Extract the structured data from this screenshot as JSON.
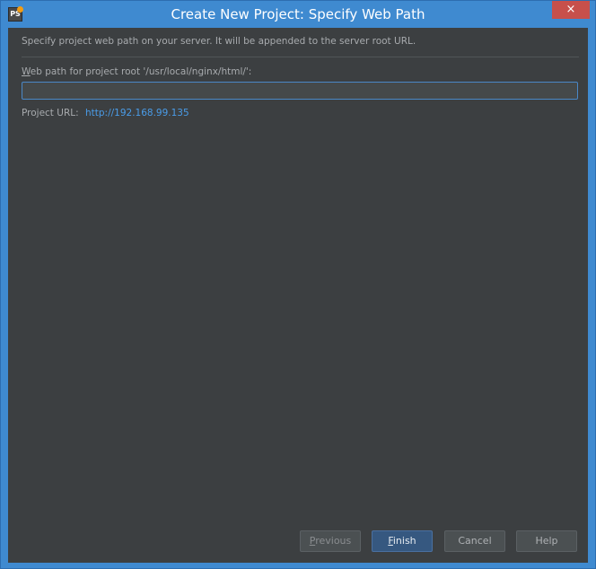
{
  "window": {
    "title": "Create New Project: Specify Web Path",
    "close_glyph": "×",
    "app_icon_text": "PS"
  },
  "dialog": {
    "description": "Specify project web path on your server. It will be appended to the server root URL.",
    "field_label_mnemonic": "W",
    "field_label_rest": "eb path for project root '/usr/local/nginx/html/':",
    "path_value": "",
    "project_url_label": "Project URL:",
    "project_url_value": "http://192.168.99.135"
  },
  "buttons": {
    "previous_mnemonic": "P",
    "previous_rest": "revious",
    "finish_mnemonic": "F",
    "finish_rest": "inish",
    "cancel": "Cancel",
    "help": "Help"
  },
  "colors": {
    "titlebar": "#3f8ad0",
    "close": "#c7504b",
    "background": "#3c3f41",
    "link": "#4a9ce8",
    "primary_button": "#365880"
  }
}
